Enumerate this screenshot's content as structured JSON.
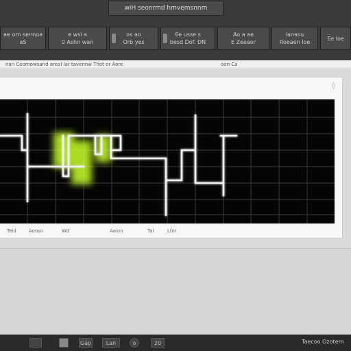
{
  "window": {
    "title": "wiH seonrmd hmvemsnnm"
  },
  "tabs": [
    {
      "line1": "ae orn sennoa",
      "line2": "aS"
    },
    {
      "line1": "e wsi a",
      "line2": "0 Ashn wan"
    },
    {
      "line1": "os ao",
      "line2": "Orb yes"
    },
    {
      "line1": "6e usse s",
      "line2": "besd Dof. DN"
    },
    {
      "line1": "Ao a ae",
      "line2": "E Zeeaor"
    },
    {
      "line1": "lanasu",
      "line2": "Roeaen loe"
    },
    {
      "line1": "",
      "line2": "Ee loe"
    }
  ],
  "address": {
    "left": "nan Ceomowsand areal lar tavennw Thot or Aore",
    "right": "oon Ca"
  },
  "scope_labels": [
    "Teid",
    "Aoosn",
    "Wd",
    "Aaion",
    "Tal",
    "Lfor"
  ],
  "taskbar": {
    "icons": [
      "",
      "",
      "Gap",
      "Lan",
      "o",
      "20"
    ],
    "clock": "Taecoo Ozotem"
  },
  "colors": {
    "trace": "#f2f2f2",
    "highlight": "#c8ff2a",
    "grid": "#3c3c3c",
    "background": "#050505"
  },
  "icons": {
    "drop": "drop-icon"
  }
}
